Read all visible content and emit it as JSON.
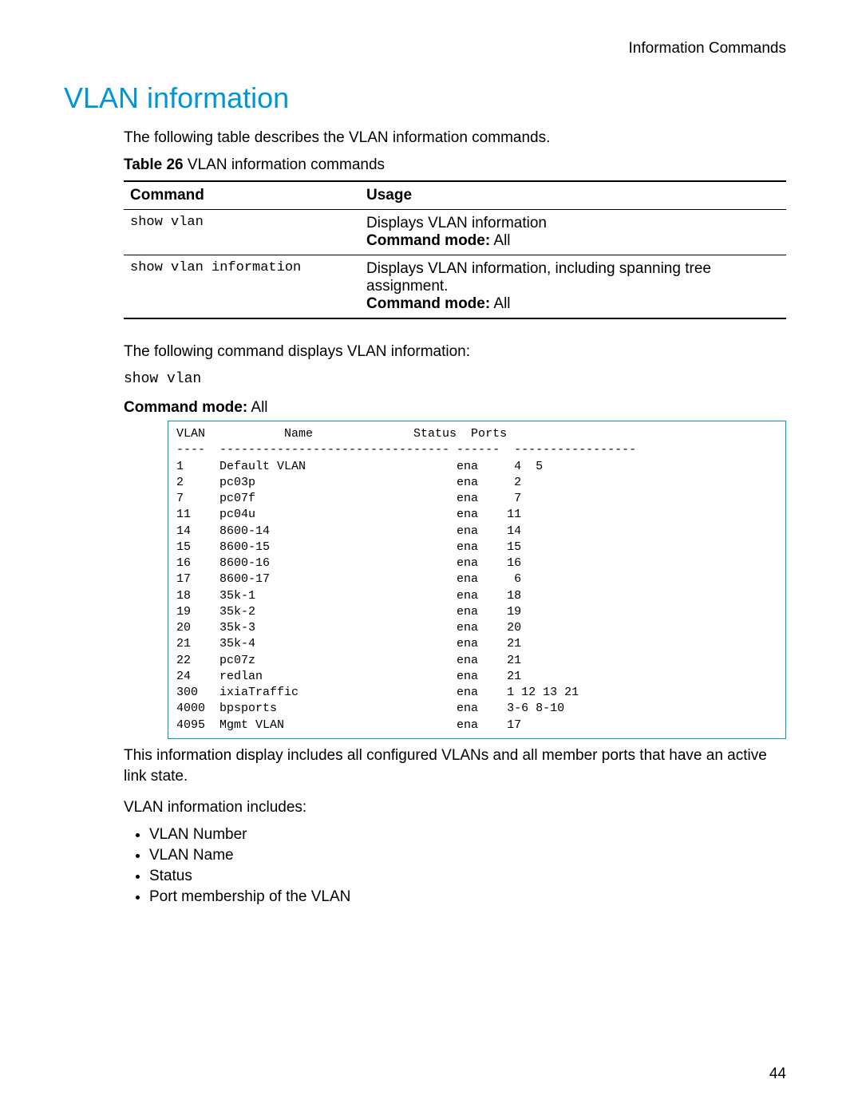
{
  "header": "Information Commands",
  "heading": "VLAN information",
  "intro": "The following table describes the VLAN information commands.",
  "table_caption_label": "Table 26",
  "table_caption_text": " VLAN information commands",
  "table": {
    "th_command": "Command",
    "th_usage": "Usage",
    "rows": [
      {
        "cmd": "show vlan",
        "desc": "Displays VLAN information",
        "mode_label": "Command mode:",
        "mode_val": " All"
      },
      {
        "cmd": "show vlan information",
        "desc": "Displays VLAN information, including spanning tree assignment.",
        "mode_label": "Command mode:",
        "mode_val": " All"
      }
    ]
  },
  "example_intro": "The following command displays VLAN information:",
  "example_cmd": "show vlan",
  "example_mode_label": "Command mode:",
  "example_mode_val": " All",
  "output": "VLAN           Name              Status  Ports\n----  -------------------------------- ------  -----------------\n1     Default VLAN                     ena     4  5\n2     pc03p                            ena     2\n7     pc07f                            ena     7\n11    pc04u                            ena    11\n14    8600-14                          ena    14\n15    8600-15                          ena    15\n16    8600-16                          ena    16\n17    8600-17                          ena     6\n18    35k-1                            ena    18\n19    35k-2                            ena    19\n20    35k-3                            ena    20\n21    35k-4                            ena    21\n22    pc07z                            ena    21\n24    redlan                           ena    21\n300   ixiaTraffic                      ena    1 12 13 21\n4000  bpsports                         ena    3-6 8-10\n4095  Mgmt VLAN                        ena    17",
  "after_output1": "This information display includes all configured VLANs and all member ports that have an active link state.",
  "after_output2": "VLAN information includes:",
  "bullets": [
    "VLAN Number",
    "VLAN Name",
    "Status",
    "Port membership of the VLAN"
  ],
  "page_number": "44"
}
